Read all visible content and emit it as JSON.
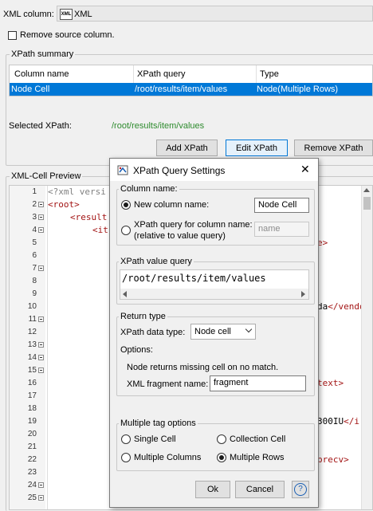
{
  "top": {
    "xml_column_label": "XML column:",
    "xml_column_value": "XML",
    "xml_icon_text": "XML",
    "remove_source_label": "Remove source column."
  },
  "xpath_summary": {
    "title": "XPath summary",
    "columns": [
      "Column name",
      "XPath query",
      "Type"
    ],
    "rows": [
      {
        "name": "Node Cell",
        "query": "/root/results/item/values",
        "type": "Node(Multiple Rows)"
      }
    ],
    "selected_label": "Selected XPath:",
    "selected_value": "/root/results/item/values",
    "add_button": "Add XPath",
    "edit_button": "Edit XPath",
    "remove_button": "Remove XPath"
  },
  "preview": {
    "title": "XML-Cell Preview",
    "line_numbers": [
      "1",
      "2",
      "3",
      "4",
      "5",
      "6",
      "7",
      "8",
      "9",
      "10",
      "11",
      "12",
      "13",
      "14",
      "15",
      "16",
      "17",
      "18",
      "19",
      "20",
      "21",
      "22",
      "23",
      "24",
      "25"
    ],
    "lines": {
      "l1": "<?xml versi",
      "l2": "<root>",
      "l3": "<result",
      "l4": "<it",
      "r5": "e>",
      "r10_text": "da",
      "r10_tag": "</vendo",
      "r16": "text>",
      "r19_text": "300IU",
      "r19_tag": "</i",
      "r22": "precv>"
    }
  },
  "dialog": {
    "title": "XPath Query Settings",
    "column_name_group": "Column name:",
    "new_column_label": "New column name:",
    "new_column_value": "Node Cell",
    "xpath_column_label_1": "XPath query for column name:",
    "xpath_column_label_2": "(relative to value query)",
    "xpath_column_placeholder": "name",
    "value_query_group": "XPath value query",
    "value_query": "/root/results/item/values",
    "return_type_group": "Return type",
    "data_type_label": "XPath data type:",
    "data_type_value": "Node cell",
    "options_label": "Options:",
    "missing_cell_note": "Node returns missing cell on no match.",
    "fragment_label": "XML fragment name:",
    "fragment_value": "fragment",
    "multiple_tag_group": "Multiple tag options",
    "opt_single_cell": "Single Cell",
    "opt_collection_cell": "Collection Cell",
    "opt_multiple_columns": "Multiple Columns",
    "opt_multiple_rows": "Multiple Rows",
    "ok_button": "Ok",
    "cancel_button": "Cancel",
    "help_symbol": "?",
    "close_symbol": "✕"
  },
  "colors": {
    "selection": "#0078d7",
    "xpath_green": "#2e8b2e",
    "xml_tag": "#a31515",
    "xml_decl": "#808080"
  }
}
